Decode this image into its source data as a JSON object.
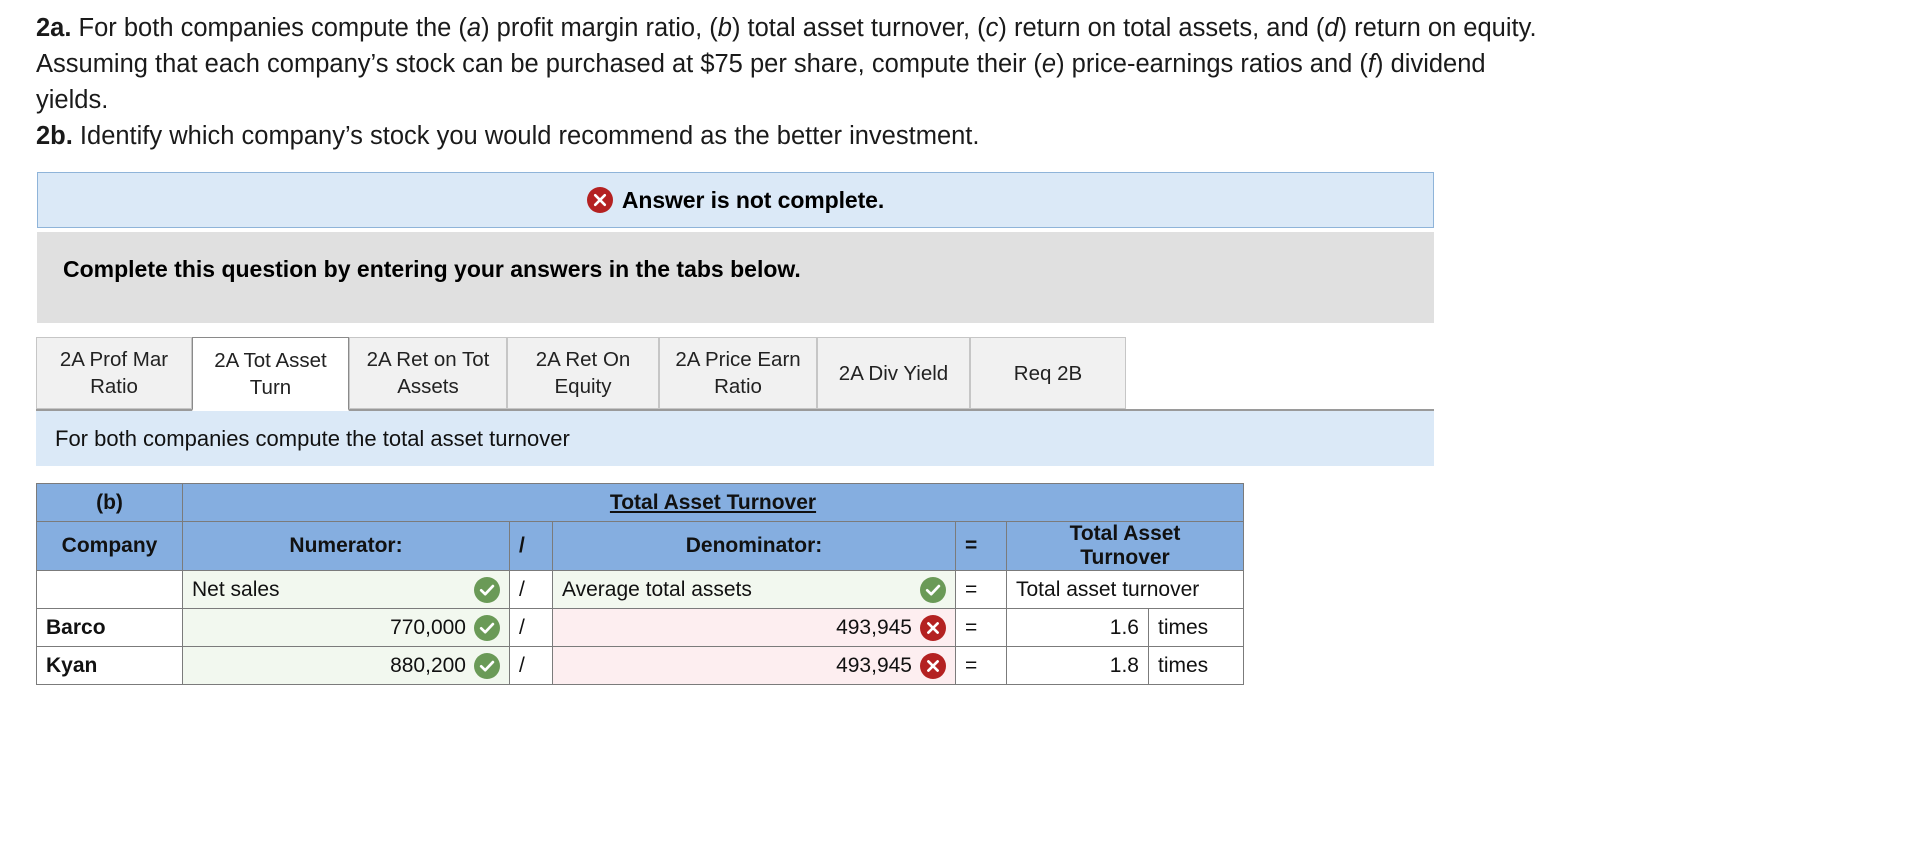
{
  "prompt": {
    "line1_prefix": "2a.",
    "line1": " For both companies compute the (a) profit margin ratio, (b) total asset turnover, (c) return on total assets, and (d) return on equity.",
    "line2": "Assuming that each company’s stock can be purchased at $75 per share, compute their (e) price-earnings ratios and (f) dividend",
    "line3": "yields.",
    "line4_prefix": "2b.",
    "line4": " Identify which company’s stock you would recommend as the better investment."
  },
  "alert": {
    "icon": "x-circle-icon",
    "text": "Answer is not complete.",
    "color": "#b42121",
    "background": "#dbe9f7"
  },
  "instruction_block": {
    "text": "Complete this question by entering your answers in the tabs below.",
    "background": "#e0e0e0"
  },
  "tabs": {
    "active_index": 1,
    "items": [
      {
        "line1": "2A Prof Mar",
        "line2": "Ratio"
      },
      {
        "line1": "2A Tot Asset",
        "line2": "Turn"
      },
      {
        "line1": "2A Ret on Tot",
        "line2": "Assets"
      },
      {
        "line1": "2A Ret On",
        "line2": "Equity"
      },
      {
        "line1": "2A Price Earn",
        "line2": "Ratio"
      },
      {
        "line1": "2A Div Yield",
        "line2": ""
      },
      {
        "line1": "Req 2B",
        "line2": ""
      }
    ]
  },
  "sub_instruction": {
    "text": "For both companies compute the total asset turnover",
    "background": "#dbe9f7"
  },
  "table": {
    "header_label": "(b)",
    "title": "Total Asset Turnover",
    "header_bg": "#85aee0",
    "columns": {
      "company": "Company",
      "numerator": "Numerator:",
      "slash": "/",
      "denominator": "Denominator:",
      "equals": "=",
      "result_line1": "Total Asset",
      "result_line2": "Turnover"
    },
    "label_row": {
      "company": "",
      "numerator": "Net sales",
      "numerator_status": "correct",
      "slash": "/",
      "denominator": "Average total assets",
      "denominator_status": "correct",
      "equals": "=",
      "result": "Total asset turnover",
      "unit": ""
    },
    "rows": [
      {
        "company": "Barco",
        "numerator": "770,000",
        "numerator_status": "correct",
        "slash": "/",
        "denominator": "493,945",
        "denominator_status": "incorrect",
        "equals": "=",
        "result": "1.6",
        "unit": "times"
      },
      {
        "company": "Kyan",
        "numerator": "880,200",
        "numerator_status": "correct",
        "slash": "/",
        "denominator": "493,945",
        "denominator_status": "incorrect",
        "equals": "=",
        "result": "1.8",
        "unit": "times"
      }
    ]
  },
  "status_icons": {
    "correct": "check-circle-icon",
    "incorrect": "x-circle-icon",
    "correct_color": "#6a9a57",
    "incorrect_color": "#b42121"
  }
}
